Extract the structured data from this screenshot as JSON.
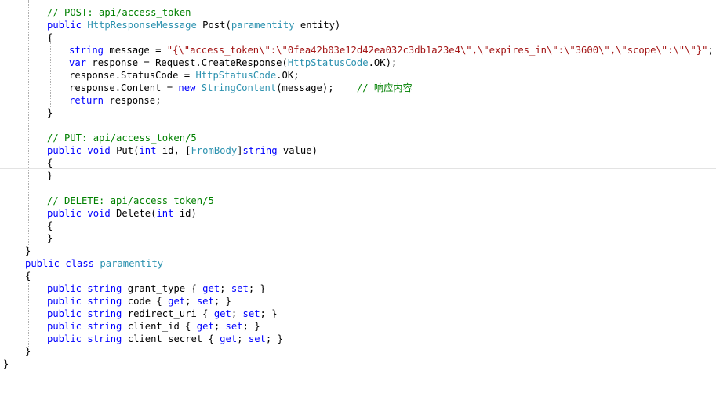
{
  "editor": {
    "lines": [
      {
        "indent": 60,
        "tokens": [
          {
            "c": "cm",
            "t": "// POST: api/access_token"
          }
        ]
      },
      {
        "indent": 60,
        "tokens": [
          {
            "c": "kw",
            "t": "public"
          },
          {
            "c": "tx",
            "t": " "
          },
          {
            "c": "ty",
            "t": "HttpResponseMessage"
          },
          {
            "c": "tx",
            "t": " Post("
          },
          {
            "c": "ty",
            "t": "paramentity"
          },
          {
            "c": "tx",
            "t": " entity)"
          }
        ]
      },
      {
        "indent": 60,
        "tokens": [
          {
            "c": "tx",
            "t": "{"
          }
        ]
      },
      {
        "indent": 88,
        "tokens": [
          {
            "c": "kw",
            "t": "string"
          },
          {
            "c": "tx",
            "t": " message = "
          },
          {
            "c": "st",
            "t": "\"{\\\"access_token\\\":\\\"0fea42b03e12d42ea032c3db1a23e4\\\",\\\"expires_in\\\":\\\"3600\\\",\\\"scope\\\":\\\"\\\"}\""
          },
          {
            "c": "tx",
            "t": ";"
          }
        ]
      },
      {
        "indent": 88,
        "tokens": [
          {
            "c": "kw",
            "t": "var"
          },
          {
            "c": "tx",
            "t": " response = Request.CreateResponse("
          },
          {
            "c": "ty",
            "t": "HttpStatusCode"
          },
          {
            "c": "tx",
            "t": ".OK);"
          }
        ]
      },
      {
        "indent": 88,
        "tokens": [
          {
            "c": "tx",
            "t": "response.StatusCode = "
          },
          {
            "c": "ty",
            "t": "HttpStatusCode"
          },
          {
            "c": "tx",
            "t": ".OK;"
          }
        ]
      },
      {
        "indent": 88,
        "tokens": [
          {
            "c": "tx",
            "t": "response.Content = "
          },
          {
            "c": "kw",
            "t": "new"
          },
          {
            "c": "tx",
            "t": " "
          },
          {
            "c": "ty",
            "t": "StringContent"
          },
          {
            "c": "tx",
            "t": "(message);    "
          },
          {
            "c": "cm",
            "t": "// 响应内容"
          }
        ]
      },
      {
        "indent": 88,
        "tokens": [
          {
            "c": "kw",
            "t": "return"
          },
          {
            "c": "tx",
            "t": " response;"
          }
        ]
      },
      {
        "indent": 60,
        "tokens": [
          {
            "c": "tx",
            "t": "}"
          }
        ]
      },
      {
        "indent": 60,
        "tokens": []
      },
      {
        "indent": 60,
        "tokens": [
          {
            "c": "cm",
            "t": "// PUT: api/access_token/5"
          }
        ]
      },
      {
        "indent": 60,
        "tokens": [
          {
            "c": "kw",
            "t": "public"
          },
          {
            "c": "tx",
            "t": " "
          },
          {
            "c": "kw",
            "t": "void"
          },
          {
            "c": "tx",
            "t": " Put("
          },
          {
            "c": "kw",
            "t": "int"
          },
          {
            "c": "tx",
            "t": " id, ["
          },
          {
            "c": "ty",
            "t": "FromBody"
          },
          {
            "c": "tx",
            "t": "]"
          },
          {
            "c": "kw",
            "t": "string"
          },
          {
            "c": "tx",
            "t": " value)"
          }
        ]
      },
      {
        "indent": 60,
        "tokens": [
          {
            "c": "tx",
            "t": "{"
          }
        ]
      },
      {
        "indent": 60,
        "tokens": [
          {
            "c": "tx",
            "t": "}"
          }
        ]
      },
      {
        "indent": 60,
        "tokens": []
      },
      {
        "indent": 60,
        "tokens": [
          {
            "c": "cm",
            "t": "// DELETE: api/access_token/5"
          }
        ]
      },
      {
        "indent": 60,
        "tokens": [
          {
            "c": "kw",
            "t": "public"
          },
          {
            "c": "tx",
            "t": " "
          },
          {
            "c": "kw",
            "t": "void"
          },
          {
            "c": "tx",
            "t": " Delete("
          },
          {
            "c": "kw",
            "t": "int"
          },
          {
            "c": "tx",
            "t": " id)"
          }
        ]
      },
      {
        "indent": 60,
        "tokens": [
          {
            "c": "tx",
            "t": "{"
          }
        ]
      },
      {
        "indent": 60,
        "tokens": [
          {
            "c": "tx",
            "t": "}"
          }
        ]
      },
      {
        "indent": 32,
        "tokens": [
          {
            "c": "tx",
            "t": "}"
          }
        ]
      },
      {
        "indent": 32,
        "tokens": [
          {
            "c": "kw",
            "t": "public"
          },
          {
            "c": "tx",
            "t": " "
          },
          {
            "c": "kw",
            "t": "class"
          },
          {
            "c": "tx",
            "t": " "
          },
          {
            "c": "ty",
            "t": "paramentity"
          }
        ]
      },
      {
        "indent": 32,
        "tokens": [
          {
            "c": "tx",
            "t": "{"
          }
        ]
      },
      {
        "indent": 60,
        "tokens": [
          {
            "c": "kw",
            "t": "public"
          },
          {
            "c": "tx",
            "t": " "
          },
          {
            "c": "kw",
            "t": "string"
          },
          {
            "c": "tx",
            "t": " grant_type { "
          },
          {
            "c": "kw",
            "t": "get"
          },
          {
            "c": "tx",
            "t": "; "
          },
          {
            "c": "kw",
            "t": "set"
          },
          {
            "c": "tx",
            "t": "; }"
          }
        ]
      },
      {
        "indent": 60,
        "tokens": [
          {
            "c": "kw",
            "t": "public"
          },
          {
            "c": "tx",
            "t": " "
          },
          {
            "c": "kw",
            "t": "string"
          },
          {
            "c": "tx",
            "t": " code { "
          },
          {
            "c": "kw",
            "t": "get"
          },
          {
            "c": "tx",
            "t": "; "
          },
          {
            "c": "kw",
            "t": "set"
          },
          {
            "c": "tx",
            "t": "; }"
          }
        ]
      },
      {
        "indent": 60,
        "tokens": [
          {
            "c": "kw",
            "t": "public"
          },
          {
            "c": "tx",
            "t": " "
          },
          {
            "c": "kw",
            "t": "string"
          },
          {
            "c": "tx",
            "t": " redirect_uri { "
          },
          {
            "c": "kw",
            "t": "get"
          },
          {
            "c": "tx",
            "t": "; "
          },
          {
            "c": "kw",
            "t": "set"
          },
          {
            "c": "tx",
            "t": "; }"
          }
        ]
      },
      {
        "indent": 60,
        "tokens": [
          {
            "c": "kw",
            "t": "public"
          },
          {
            "c": "tx",
            "t": " "
          },
          {
            "c": "kw",
            "t": "string"
          },
          {
            "c": "tx",
            "t": " client_id { "
          },
          {
            "c": "kw",
            "t": "get"
          },
          {
            "c": "tx",
            "t": "; "
          },
          {
            "c": "kw",
            "t": "set"
          },
          {
            "c": "tx",
            "t": "; }"
          }
        ]
      },
      {
        "indent": 60,
        "tokens": [
          {
            "c": "kw",
            "t": "public"
          },
          {
            "c": "tx",
            "t": " "
          },
          {
            "c": "kw",
            "t": "string"
          },
          {
            "c": "tx",
            "t": " client_secret { "
          },
          {
            "c": "kw",
            "t": "get"
          },
          {
            "c": "tx",
            "t": "; "
          },
          {
            "c": "kw",
            "t": "set"
          },
          {
            "c": "tx",
            "t": "; }"
          }
        ]
      },
      {
        "indent": 32,
        "tokens": [
          {
            "c": "tx",
            "t": "}"
          }
        ]
      },
      {
        "indent": 4,
        "tokens": [
          {
            "c": "tx",
            "t": "}"
          }
        ]
      }
    ]
  }
}
